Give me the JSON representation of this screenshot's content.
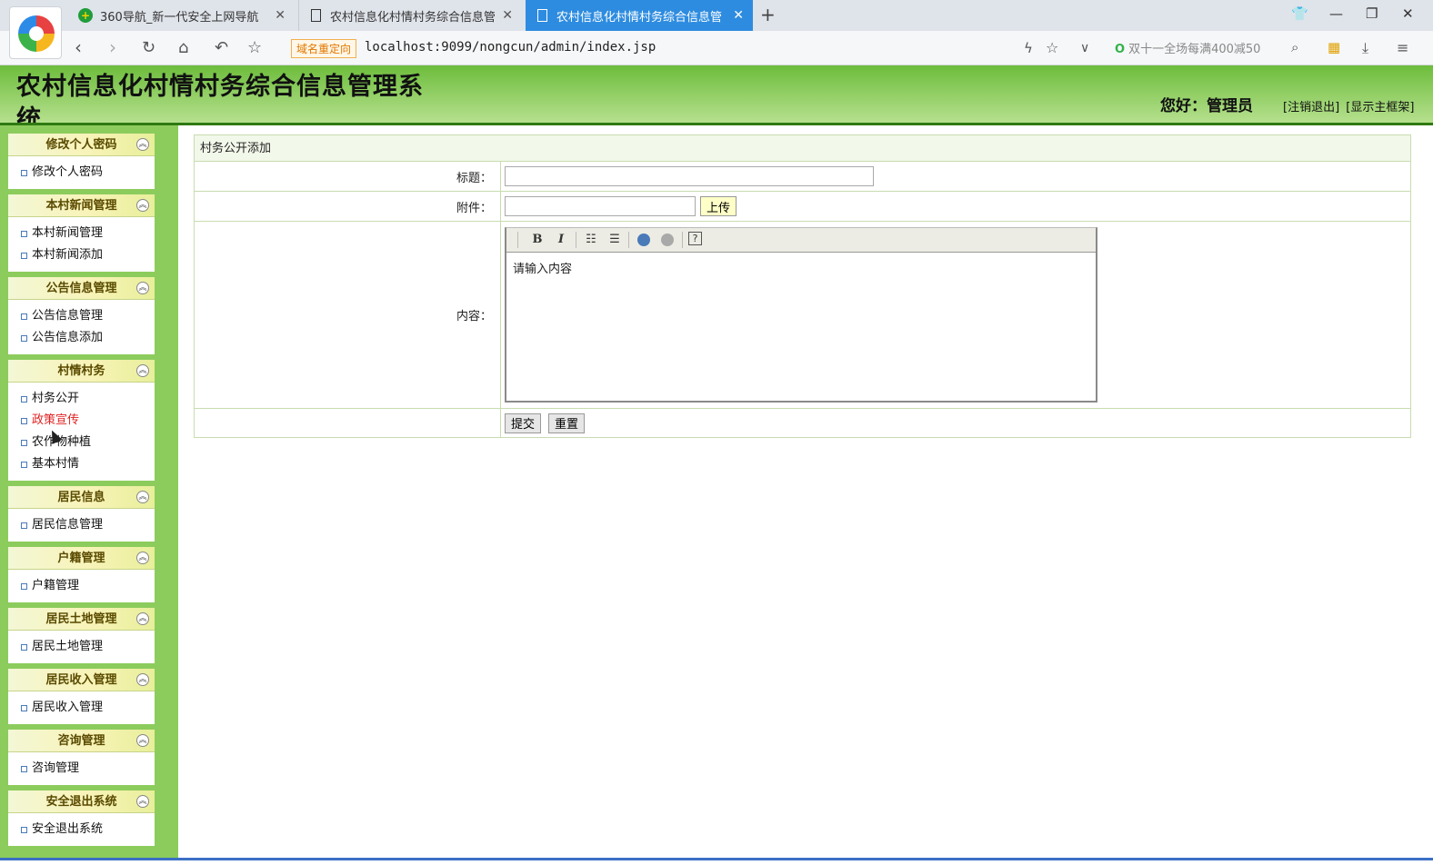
{
  "browser": {
    "tabs": [
      {
        "title": "360导航_新一代安全上网导航",
        "active": false
      },
      {
        "title": "农村信息化村情村务综合信息管",
        "active": false
      },
      {
        "title": "农村信息化村情村务综合信息管",
        "active": true
      }
    ],
    "redirect_badge": "域名重定向",
    "url": "localhost:9099/nongcun/admin/index.jsp",
    "promo": "双十一全场每满400减50",
    "accent_color": "#2e8ce0"
  },
  "header": {
    "title": "农村信息化村情村务综合信息管理系统",
    "greeting": "您好：管理员",
    "logout_link": "[注销退出]",
    "frame_link": "[显示主框架]"
  },
  "sidebar": {
    "groups": [
      {
        "title": "修改个人密码",
        "items": [
          "修改个人密码"
        ]
      },
      {
        "title": "本村新闻管理",
        "items": [
          "本村新闻管理",
          "本村新闻添加"
        ]
      },
      {
        "title": "公告信息管理",
        "items": [
          "公告信息管理",
          "公告信息添加"
        ]
      },
      {
        "title": "村情村务",
        "items": [
          "村务公开",
          "政策宣传",
          "农作物种植",
          "基本村情"
        ]
      },
      {
        "title": "居民信息",
        "items": [
          "居民信息管理"
        ]
      },
      {
        "title": "户籍管理",
        "items": [
          "户籍管理"
        ]
      },
      {
        "title": "居民土地管理",
        "items": [
          "居民土地管理"
        ]
      },
      {
        "title": "居民收入管理",
        "items": [
          "居民收入管理"
        ]
      },
      {
        "title": "咨询管理",
        "items": [
          "咨询管理"
        ]
      },
      {
        "title": "安全退出系统",
        "items": [
          "安全退出系统"
        ]
      }
    ],
    "active_item": "政策宣传"
  },
  "form": {
    "caption": "村务公开添加",
    "title_label": "标题：",
    "title_value": "",
    "attach_label": "附件：",
    "attach_value": "",
    "upload_button": "上传",
    "content_label": "内容：",
    "editor_text": "请输入内容",
    "submit_button": "提交",
    "reset_button": "重置"
  }
}
